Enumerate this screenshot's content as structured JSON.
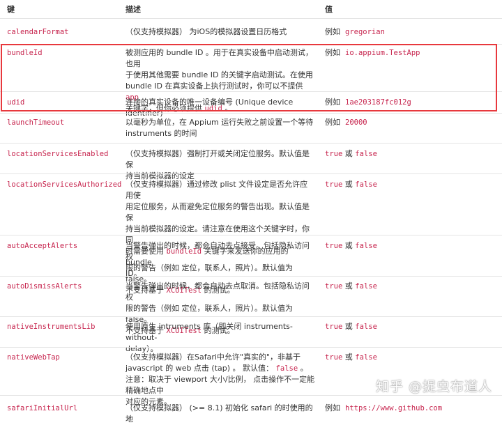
{
  "header": {
    "key": "键",
    "description": "描述",
    "value": "值"
  },
  "prefix_example": "例如",
  "word_or": "或",
  "colors": {
    "code": "#c7254e",
    "highlight_border": "#e8383d",
    "row_border": "#e4e4e4"
  },
  "rows": [
    {
      "key": "calendarFormat",
      "desc": [
        [
          "t",
          "（仅支持模拟器）  为iOS的模拟器设置日历格式"
        ]
      ],
      "value": {
        "type": "example",
        "code": "gregorian"
      }
    },
    {
      "key": "bundleId",
      "desc": [
        [
          "t",
          "被测应用的 bundle ID 。用于在真实设备中启动测试，也用"
        ],
        [
          "t",
          "于使用其他需要 bundle ID 的关键字启动测试。在使用"
        ],
        [
          "t",
          "bundle ID 在真实设备上执行测试时，你可以不提供 "
        ],
        [
          "c",
          "app"
        ],
        [
          "t",
          "关键字，但你必须提供 "
        ],
        [
          "c",
          "udid"
        ],
        [
          "t",
          " 。"
        ]
      ],
      "value": {
        "type": "example",
        "code": "io.appium.TestApp"
      }
    },
    {
      "key": "udid",
      "desc": [
        [
          "t",
          "连接的真实设备的唯一设备编号 (Unique device identifier)"
        ]
      ],
      "value": {
        "type": "example",
        "code": "1ae203187fc012g"
      }
    },
    {
      "key": "launchTimeout",
      "desc": [
        [
          "t",
          "以毫秒为单位，在 Appium 运行失败之前设置一个等待"
        ],
        [
          "t",
          "instruments 的时间"
        ]
      ],
      "value": {
        "type": "example",
        "code": "20000"
      }
    },
    {
      "key": "locationServicesEnabled",
      "desc": [
        [
          "t",
          "（仅支持模拟器）强制打开或关闭定位服务。默认值是保"
        ],
        [
          "t",
          "持当前模拟器的设定"
        ]
      ],
      "value": {
        "type": "bool",
        "a": "true",
        "b": "false"
      }
    },
    {
      "key": "locationServicesAuthorized",
      "desc": [
        [
          "t",
          "（仅支持模拟器）通过修改 plist 文件设定是否允许应用使"
        ],
        [
          "t",
          "用定位服务，从而避免定位服务的警告出现。默认值是保"
        ],
        [
          "t",
          "持当前模拟器的设定。请注意在使用这个关键字时，你同"
        ],
        [
          "t",
          "时需要使用 "
        ],
        [
          "c",
          "bundleId"
        ],
        [
          "t",
          " 关键字来发送你的应用的 bundle"
        ],
        [
          "t",
          "ID。"
        ]
      ],
      "value": {
        "type": "bool",
        "a": "true",
        "b": "false"
      }
    },
    {
      "key": "autoAcceptAlerts",
      "desc": [
        [
          "t",
          "当警告弹出的时候，都会自动去点接受。包括隐私访问权"
        ],
        [
          "t",
          "限的警告（例如 定位，联系人，照片）。默认值为 false。"
        ],
        [
          "t",
          "不支持基于 "
        ],
        [
          "c",
          "XCUITest"
        ],
        [
          "t",
          " 的测试。"
        ]
      ],
      "value": {
        "type": "bool",
        "a": "true",
        "b": "false"
      }
    },
    {
      "key": "autoDismissAlerts",
      "desc": [
        [
          "t",
          "当警告弹出的时候，都会自动去点取消。包括隐私访问权"
        ],
        [
          "t",
          "限的警告（例如 定位，联系人，照片）。默认值为 false。"
        ],
        [
          "t",
          "不支持基于 "
        ],
        [
          "c",
          "XCUITest"
        ],
        [
          "t",
          " 的测试。"
        ]
      ],
      "value": {
        "type": "bool",
        "a": "true",
        "b": "false"
      }
    },
    {
      "key": "nativeInstrumentsLib",
      "desc": [
        [
          "t",
          "使用原生 intruments 库（即关闭 instruments-without-"
        ],
        [
          "t",
          "delay）。"
        ]
      ],
      "value": {
        "type": "bool",
        "a": "true",
        "b": "false"
      }
    },
    {
      "key": "nativeWebTap",
      "desc": [
        [
          "t",
          "（仅支持模拟器）在Safari中允许\"真实的\"，非基于"
        ],
        [
          "t",
          "javascript 的 web 点击 (tap) 。 默认值： "
        ],
        [
          "c",
          "false"
        ],
        [
          "t",
          " 。注意："
        ],
        [
          "t",
          "取决于 viewport 大小/比例， 点击操作不一定能精确地点中"
        ],
        [
          "t",
          "对应的元素。"
        ]
      ],
      "value": {
        "type": "bool",
        "a": "true",
        "b": "false"
      }
    },
    {
      "key": "safariInitialUrl",
      "desc": [
        [
          "t",
          "（仅支持模拟器） (>= 8.1) 初始化 safari 的时使用的地"
        ]
      ],
      "value": {
        "type": "example",
        "code": "https://www.github.com"
      }
    }
  ],
  "watermark": "知乎 @捉虫布道人"
}
